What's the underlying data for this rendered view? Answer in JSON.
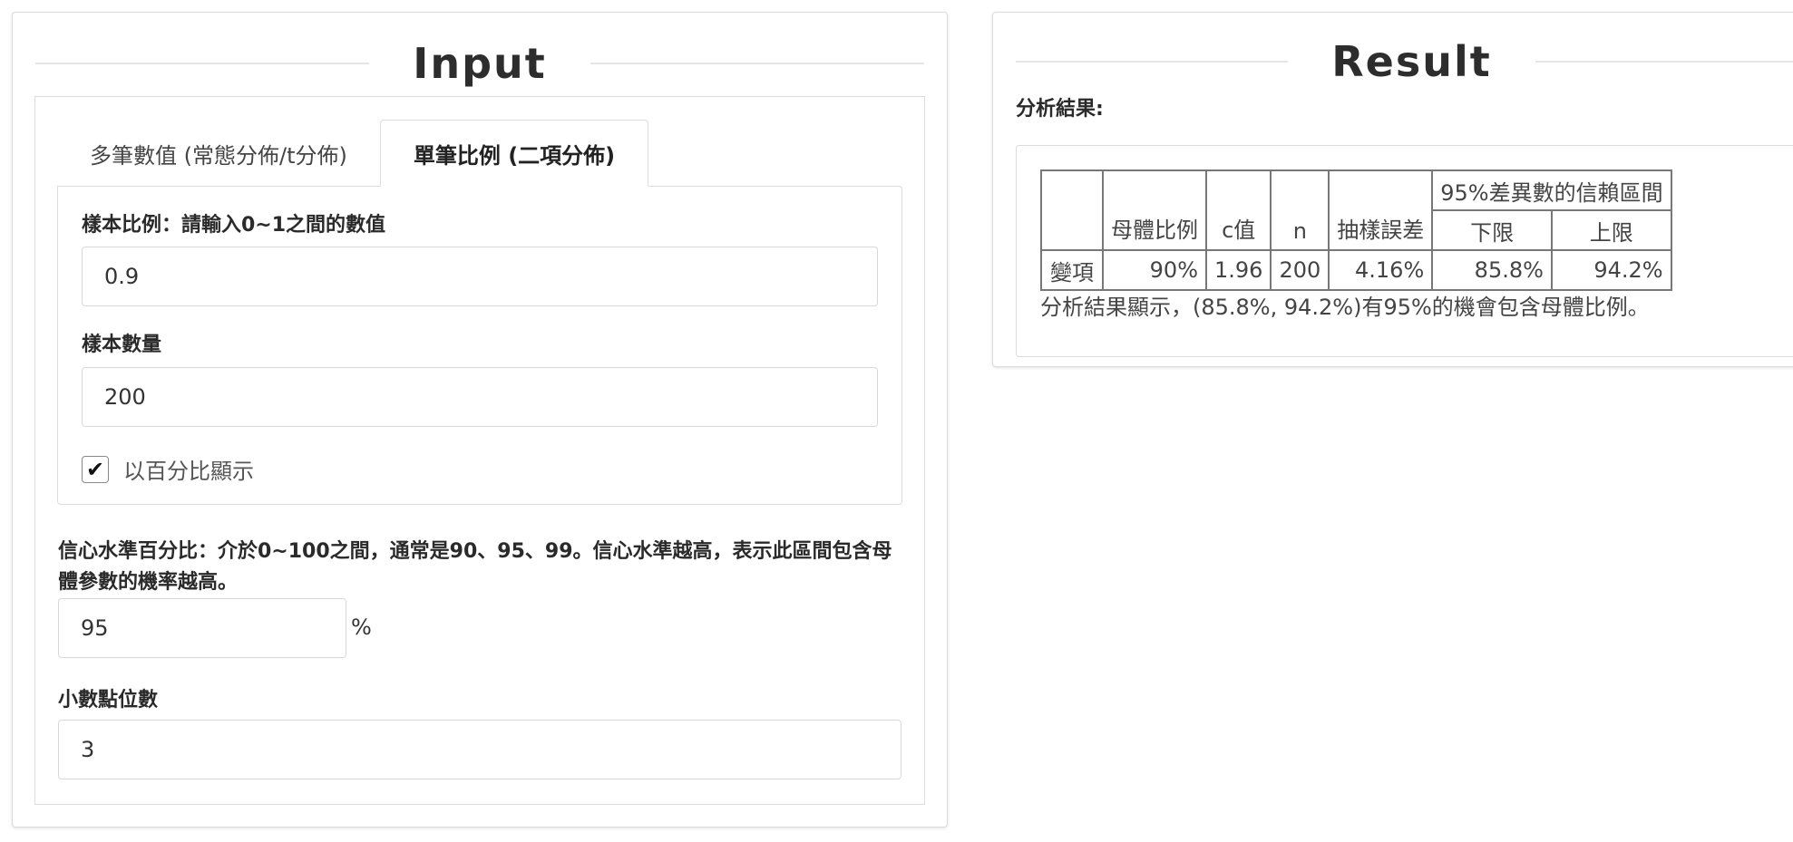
{
  "input_panel": {
    "title": "Input",
    "tabs": [
      {
        "label": "多筆數值 (常態分佈/t分佈)"
      },
      {
        "label": "單筆比例 (二項分佈)"
      }
    ],
    "sample_proportion": {
      "label": "樣本比例：請輸入0~1之間的數值",
      "value": "0.9"
    },
    "sample_size": {
      "label": "樣本數量",
      "value": "200"
    },
    "show_percent": {
      "label": "以百分比顯示",
      "checked_glyph": "✔"
    },
    "confidence": {
      "label": "信心水準百分比：介於0~100之間，通常是90、95、99。信心水準越高，表示此區間包含母體參數的機率越高。",
      "value": "95",
      "unit": "%"
    },
    "decimals": {
      "label": "小數點位數",
      "value": "3"
    }
  },
  "result_panel": {
    "title": "Result",
    "label": "分析結果:",
    "table": {
      "headers": {
        "population_ratio": "母體比例",
        "c_value": "c值",
        "n": "n",
        "sampling_error": "抽樣誤差",
        "interval": "95%差異數的信賴區間",
        "lower": "下限",
        "upper": "上限"
      },
      "row": {
        "name": "變項",
        "population_ratio": "90%",
        "c_value": "1.96",
        "n": "200",
        "sampling_error": "4.16%",
        "lower": "85.8%",
        "upper": "94.2%"
      }
    },
    "summary": "分析結果顯示，(85.8%, 94.2%)有95%的機會包含母體比例。"
  }
}
